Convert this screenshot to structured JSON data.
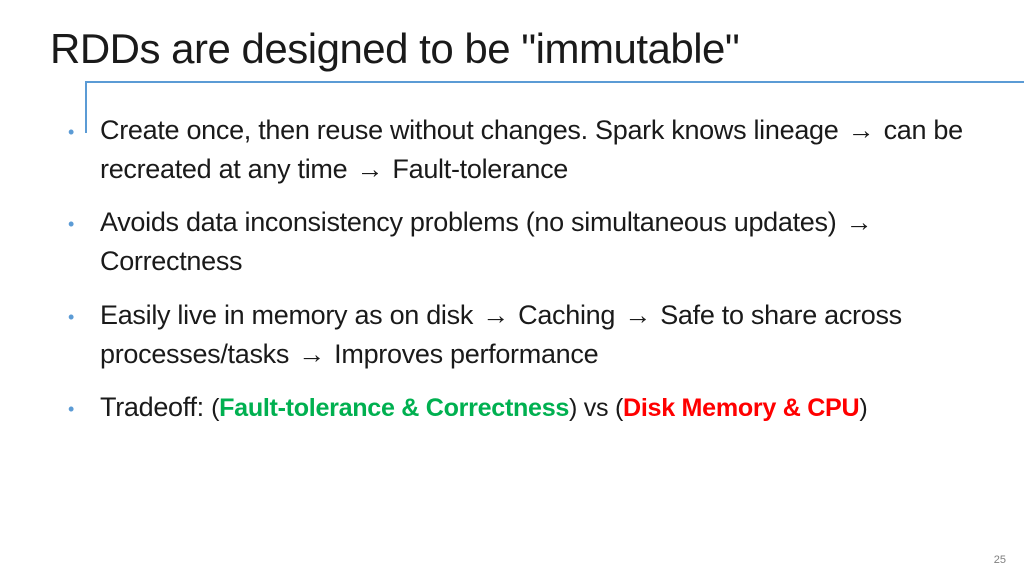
{
  "slide": {
    "title": "RDDs are designed to be \"immutable\"",
    "arrow": "→",
    "bullets": {
      "b1_a": "Create once, then reuse without changes.  Spark knows lineage ",
      "b1_b": " can be recreated at any time ",
      "b1_c": " Fault-tolerance",
      "b2_a": "Avoids data inconsistency problems  (no simultaneous updates) ",
      "b2_b": " Correctness",
      "b3_a": "Easily live in memory as on disk ",
      "b3_b": " Caching ",
      "b3_c": " Safe to share across processes/tasks ",
      "b3_d": " Improves performance",
      "b4_a": "Tradeoff: ",
      "b4_p1": "(",
      "b4_green": "Fault-tolerance & Correctness",
      "b4_p2": ")  vs (",
      "b4_red": "Disk Memory & CPU",
      "b4_p3": ")"
    },
    "page_number": "25"
  }
}
